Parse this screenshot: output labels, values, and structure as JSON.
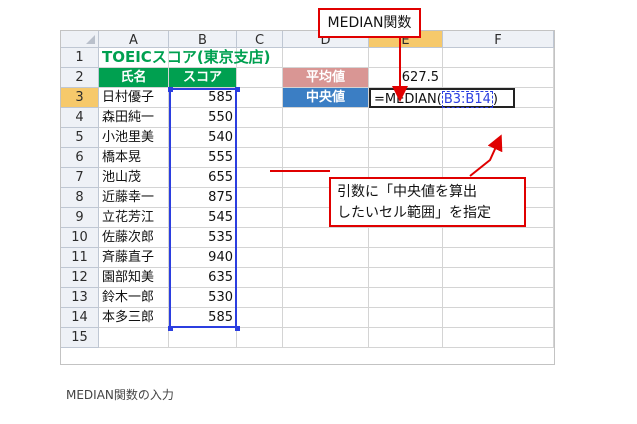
{
  "columns": [
    "A",
    "B",
    "C",
    "D",
    "E",
    "F"
  ],
  "active_column": "E",
  "rows": [
    "1",
    "2",
    "3",
    "4",
    "5",
    "6",
    "7",
    "8",
    "9",
    "10",
    "11",
    "12",
    "13",
    "14",
    "15"
  ],
  "active_row": "3",
  "title": "TOEICスコア(東京支店)",
  "headers": {
    "name": "氏名",
    "score": "スコア"
  },
  "records": [
    {
      "name": "日村優子",
      "score": "585"
    },
    {
      "name": "森田純一",
      "score": "550"
    },
    {
      "name": "小池里美",
      "score": "540"
    },
    {
      "name": "橋本晃",
      "score": "555"
    },
    {
      "name": "池山茂",
      "score": "655"
    },
    {
      "name": "近藤幸一",
      "score": "875"
    },
    {
      "name": "立花芳江",
      "score": "545"
    },
    {
      "name": "佐藤次郎",
      "score": "535"
    },
    {
      "name": "斉藤直子",
      "score": "940"
    },
    {
      "name": "園部知美",
      "score": "635"
    },
    {
      "name": "鈴木一郎",
      "score": "530"
    },
    {
      "name": "本多三郎",
      "score": "585"
    }
  ],
  "summary": {
    "average_label": "平均値",
    "average_value": "627.5",
    "median_label": "中央値",
    "formula_prefix": "=MEDIAN(",
    "formula_ref": "B3:B14",
    "formula_suffix": ")"
  },
  "callouts": {
    "function_name": "MEDIAN関数",
    "instruction_line1": "引数に「中央値を算出",
    "instruction_line2": "したいセル範囲」を指定"
  },
  "caption": "MEDIAN関数の入力",
  "colors": {
    "header_green": "#00a050",
    "label_pink": "#d99694",
    "label_blue": "#3b7ec4",
    "range_blue": "#2b3ee0",
    "callout_red": "#e00000",
    "active_header": "#f6c96b"
  }
}
